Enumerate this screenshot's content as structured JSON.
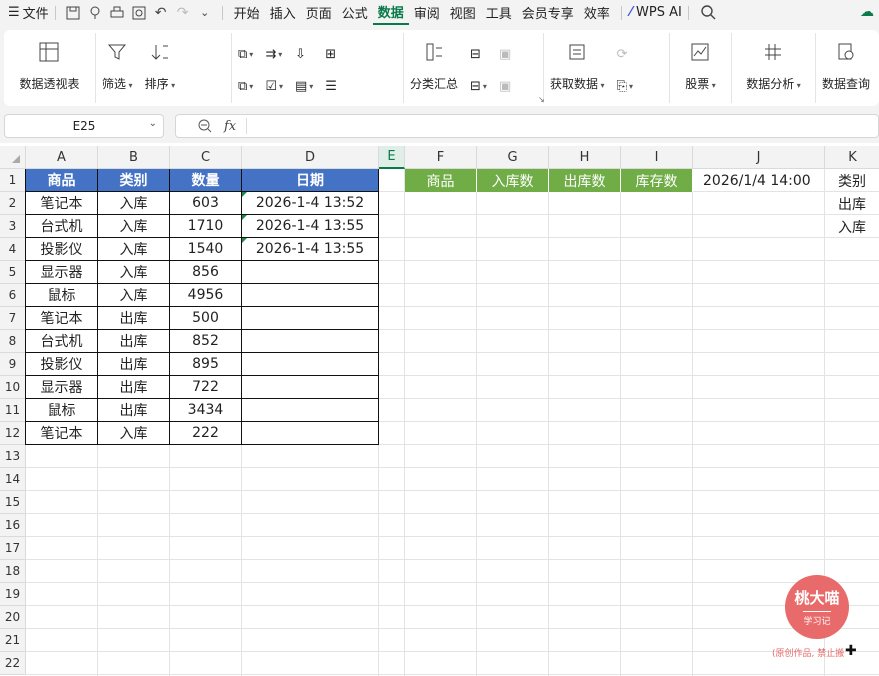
{
  "menubar": {
    "file": "文件",
    "tabs": [
      "开始",
      "插入",
      "页面",
      "公式",
      "数据",
      "审阅",
      "视图",
      "工具",
      "会员专享",
      "效率"
    ],
    "active_tab": "数据",
    "wps_ai": "WPS AI"
  },
  "ribbon": {
    "pivot": "数据透视表",
    "filter": "筛选",
    "sort": "排序",
    "subtotal": "分类汇总",
    "get_data": "获取数据",
    "stock": "股票",
    "analysis": "数据分析",
    "query": "数据查询"
  },
  "formula_bar": {
    "name_box": "E25",
    "fx": "fx",
    "value": ""
  },
  "sheet": {
    "columns": [
      "A",
      "B",
      "C",
      "D",
      "E",
      "F",
      "G",
      "H",
      "I",
      "J",
      "K"
    ],
    "selected_column": "E",
    "rows": [
      "1",
      "2",
      "3",
      "4",
      "5",
      "6",
      "7",
      "8",
      "9",
      "10",
      "11",
      "12",
      "13",
      "14",
      "15",
      "16",
      "17",
      "18",
      "19",
      "20",
      "21",
      "22"
    ],
    "table_headers": [
      "商品",
      "类别",
      "数量",
      "日期"
    ],
    "table_rows": [
      [
        "笔记本",
        "入库",
        "603",
        "2026-1-4 13:52"
      ],
      [
        "台式机",
        "入库",
        "1710",
        "2026-1-4 13:55"
      ],
      [
        "投影仪",
        "入库",
        "1540",
        "2026-1-4 13:55"
      ],
      [
        "显示器",
        "入库",
        "856",
        ""
      ],
      [
        "鼠标",
        "入库",
        "4956",
        ""
      ],
      [
        "笔记本",
        "出库",
        "500",
        ""
      ],
      [
        "台式机",
        "出库",
        "852",
        ""
      ],
      [
        "投影仪",
        "出库",
        "895",
        ""
      ],
      [
        "显示器",
        "出库",
        "722",
        ""
      ],
      [
        "鼠标",
        "出库",
        "3434",
        ""
      ],
      [
        "笔记本",
        "入库",
        "222",
        ""
      ]
    ],
    "summary_headers": [
      "商品",
      "入库数",
      "出库数",
      "库存数"
    ],
    "j1": "2026/1/4 14:00",
    "k_col": [
      "类别",
      "出库",
      "入库"
    ]
  },
  "watermark": {
    "name": "桃大喵",
    "sub": "学习记",
    "note": "(原创作品, 禁止搬"
  },
  "colors": {
    "accent": "#0a7a4a",
    "header_blue": "#4472c4",
    "header_green": "#70ad47",
    "watermark": "#e86a6a"
  }
}
